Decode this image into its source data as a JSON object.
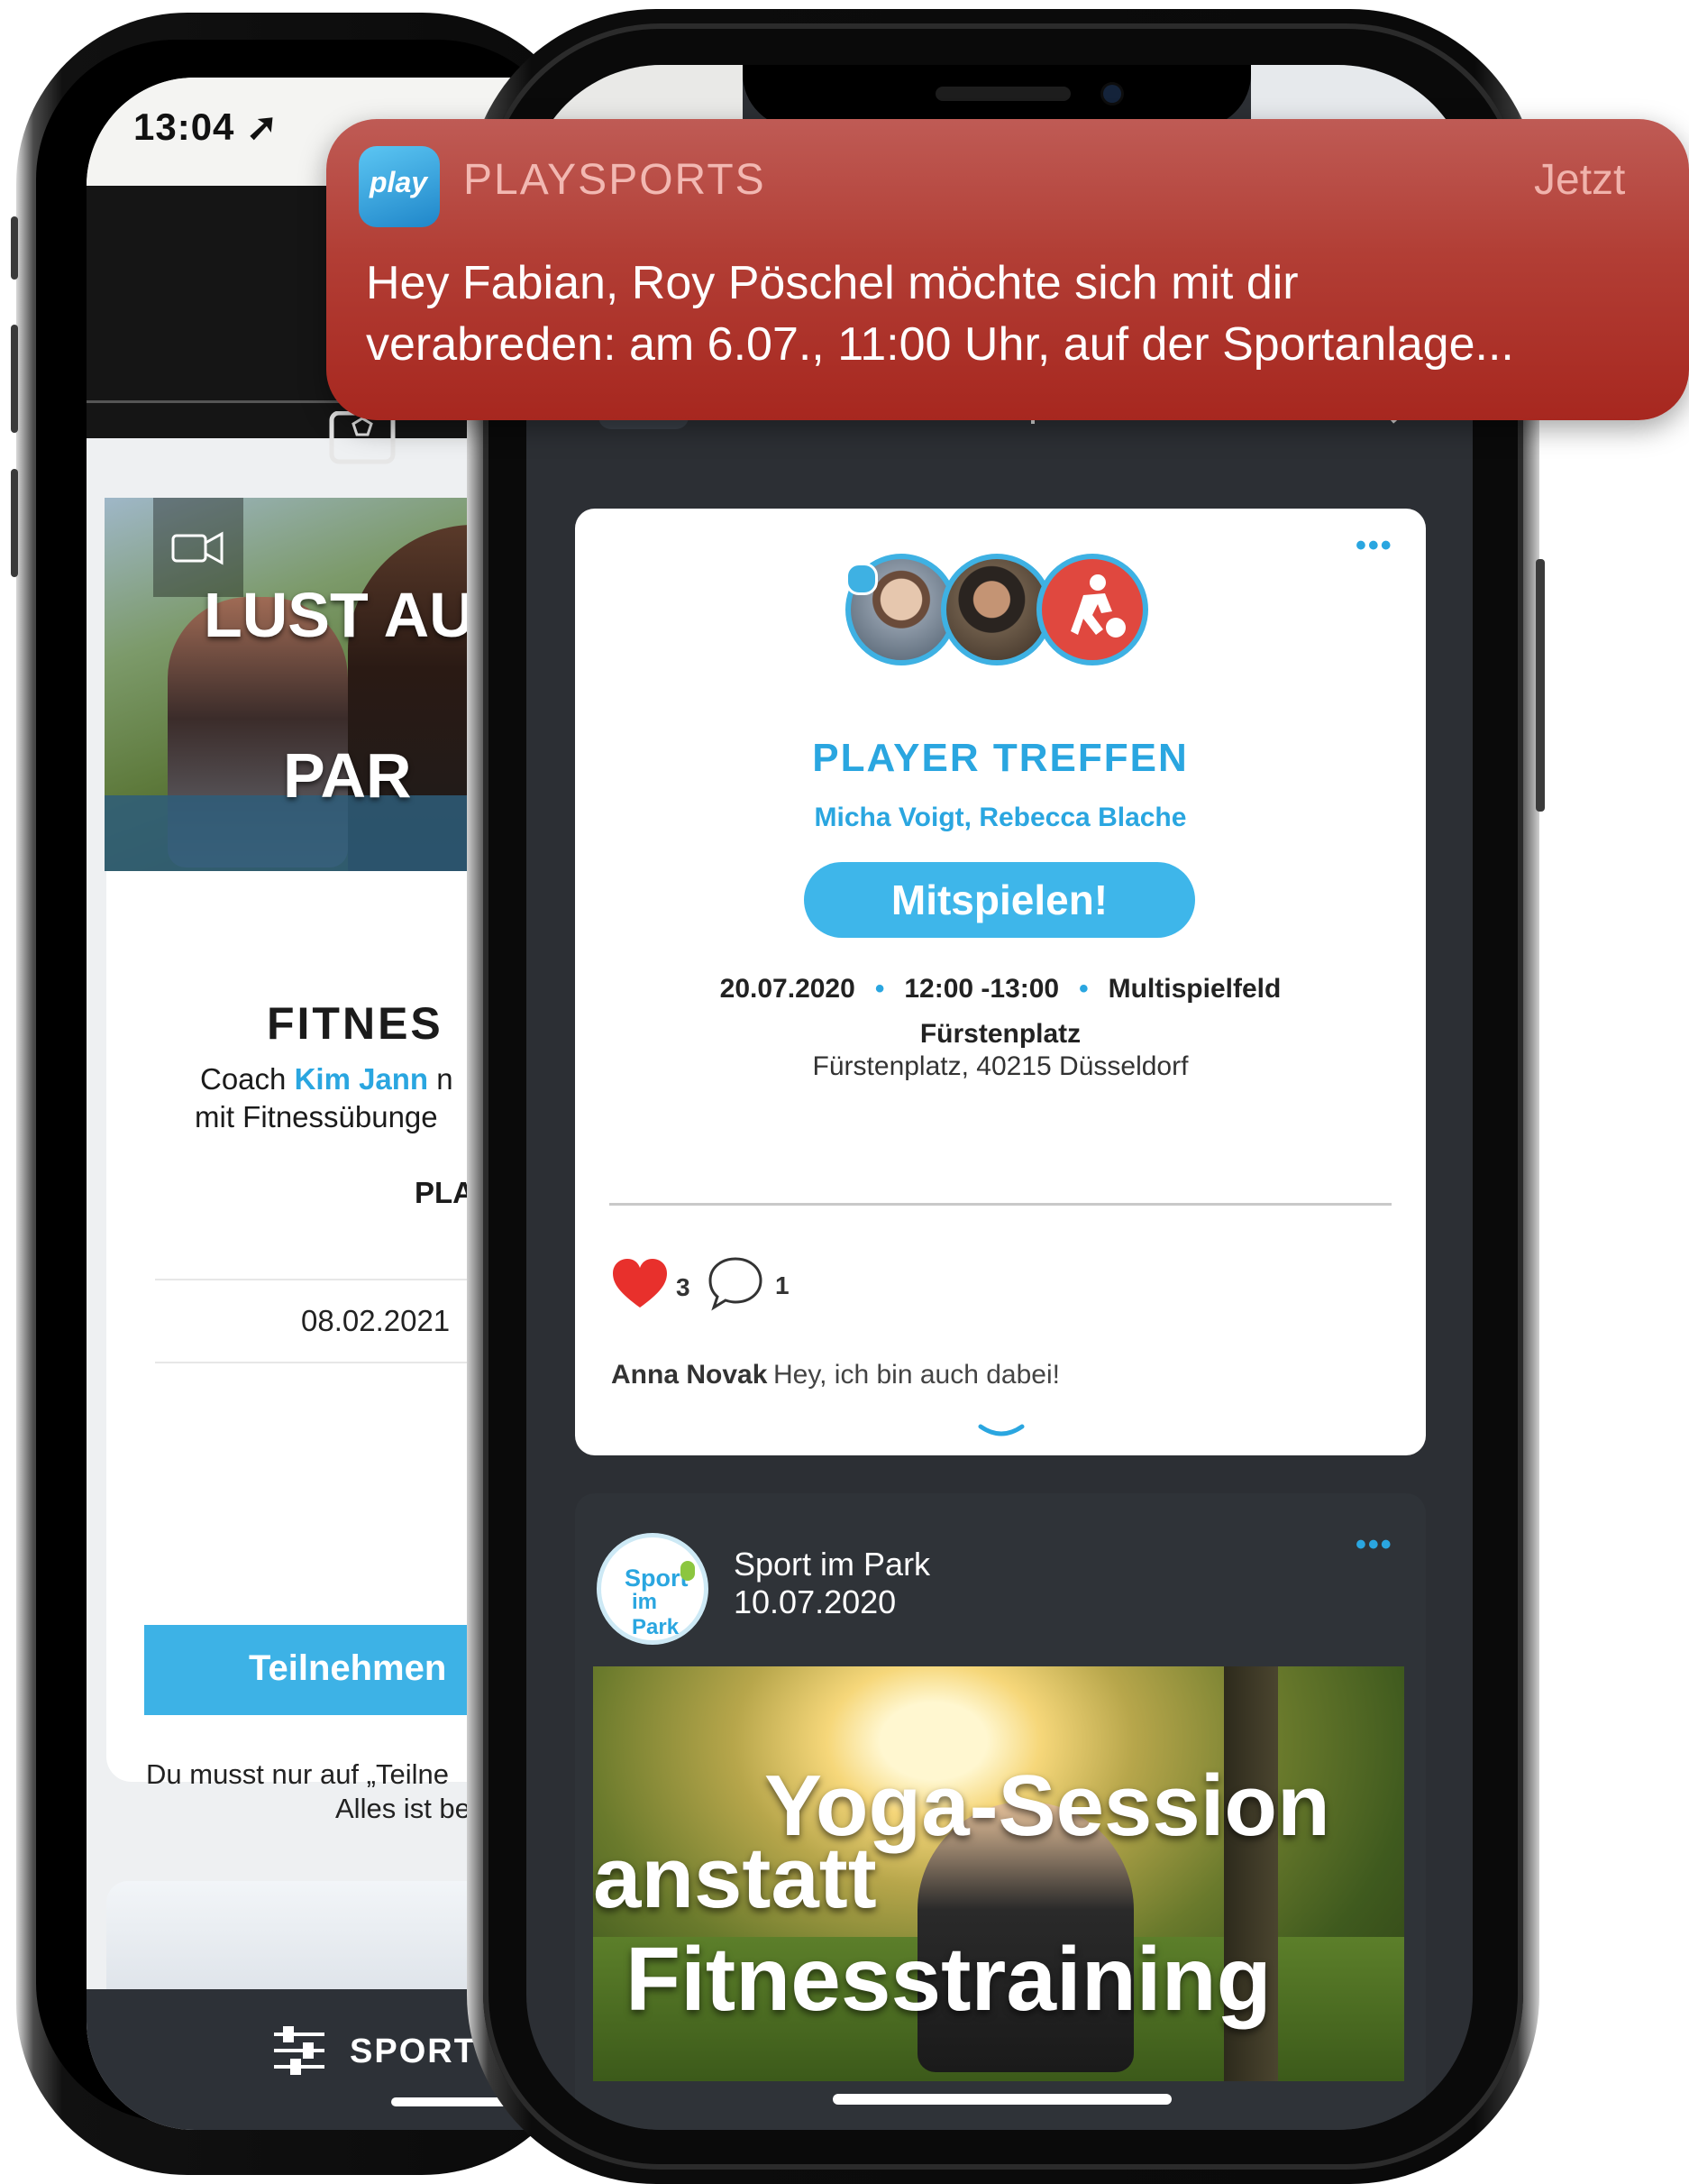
{
  "notification": {
    "app_name": "PLAYSPORTS",
    "time": "Jetzt",
    "icon_text": "play",
    "line1": "Hey Fabian, Roy Pöschel  möchte sich mit dir",
    "line2": "verabreden: am 6.07., 11:00 Uhr, auf der Sportanlage..."
  },
  "back_phone": {
    "status_time": "13:04 ➚",
    "card": {
      "banner_line1": "LUST AU",
      "banner_line2": "PAR",
      "title": "FITNES",
      "coach_prefix": "Coach ",
      "coach_name": "Kim Jann",
      "coach_suffix": " n",
      "description": "mit Fitnessübunge",
      "place": "PLA",
      "date": "08.02.2021",
      "button": "Teilnehmen",
      "note_line1": "Du musst nur auf „Teilne",
      "note_line2": "Alles ist be"
    },
    "bottom_bar_label": "SPORT"
  },
  "front_phone": {
    "nav_icons": [
      "feed-icon",
      "checklist-icon",
      "add-user-icon",
      "megaphone-icon",
      "search-icon"
    ],
    "player_card": {
      "menu": "•••",
      "title": "PLAYER TREFFEN",
      "names": "Micha Voigt, Rebecca Blache",
      "button": "Mitspielen!",
      "date": "20.07.2020",
      "time": "12:00 -13:00",
      "field": "Multispielfeld",
      "venue": "Fürstenplatz",
      "address": "Fürstenplatz, 40215 Düsseldorf",
      "likes": "3",
      "comments": "1",
      "comment_author": "Anna Novak",
      "comment_text": "Hey, ich bin auch dabei!"
    },
    "post_card": {
      "menu": "•••",
      "logo_line1": "Sport",
      "logo_line2": "im Park",
      "name": "Sport im Park",
      "date": "10.07.2020",
      "image_line1": "Yoga-Session",
      "image_line2": "anstatt",
      "image_line3": "Fitnesstraining"
    }
  },
  "colors": {
    "accent_blue": "#2aa6e0",
    "notification_red": "#b23e35",
    "dark_bg": "#2c2f34",
    "heart_red": "#e8302c"
  }
}
